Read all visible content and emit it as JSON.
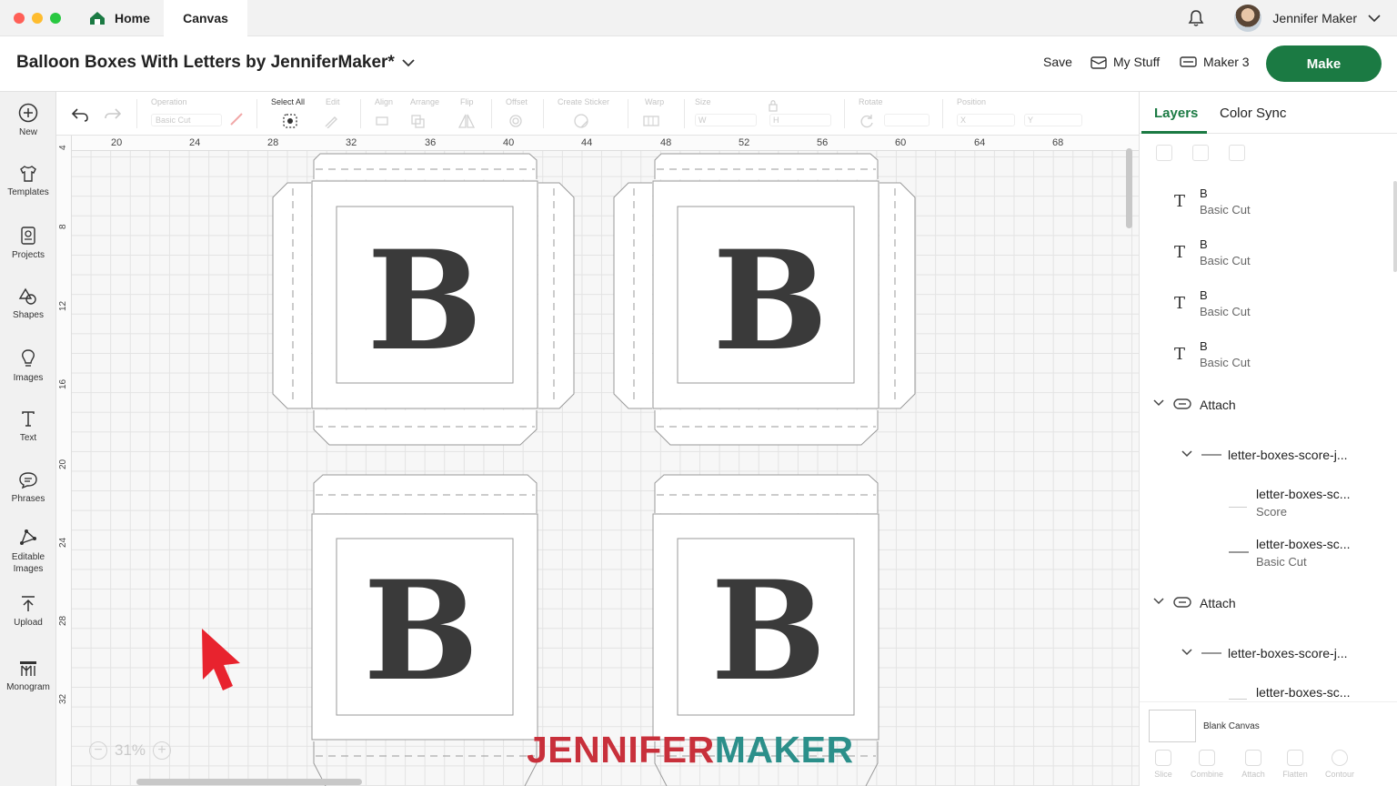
{
  "window": {
    "tabs": [
      {
        "label": "Home"
      },
      {
        "label": "Canvas"
      }
    ],
    "user_name": "Jennifer Maker"
  },
  "header": {
    "project_title": "Balloon Boxes With Letters by JenniferMaker*",
    "save_label": "Save",
    "my_stuff_label": "My Stuff",
    "machine_label": "Maker 3",
    "make_label": "Make"
  },
  "sidebar": {
    "items": [
      {
        "label": "New",
        "icon": "plus-circle-icon"
      },
      {
        "label": "Templates",
        "icon": "tshirt-icon"
      },
      {
        "label": "Projects",
        "icon": "projects-icon"
      },
      {
        "label": "Shapes",
        "icon": "shapes-icon"
      },
      {
        "label": "Images",
        "icon": "lightbulb-icon"
      },
      {
        "label": "Text",
        "icon": "text-icon"
      },
      {
        "label": "Phrases",
        "icon": "speech-bubble-icon"
      },
      {
        "label": "Editable Images",
        "icon": "editable-images-icon"
      },
      {
        "label": "Upload",
        "icon": "upload-icon"
      },
      {
        "label": "Monogram",
        "icon": "monogram-icon"
      }
    ]
  },
  "toolbar": {
    "operation_label": "Operation",
    "operation_value": "Basic Cut",
    "select_all_label": "Select All",
    "edit_label": "Edit",
    "align_label": "Align",
    "arrange_label": "Arrange",
    "flip_label": "Flip",
    "offset_label": "Offset",
    "create_sticker_label": "Create Sticker",
    "warp_label": "Warp",
    "size_label": "Size",
    "size_w": "W",
    "size_h": "H",
    "rotate_label": "Rotate",
    "position_label": "Position",
    "pos_x": "X",
    "pos_y": "Y"
  },
  "canvas": {
    "ruler_top": [
      "20",
      "24",
      "28",
      "32",
      "36",
      "40",
      "44",
      "48",
      "52",
      "56",
      "60",
      "64",
      "68"
    ],
    "ruler_left": [
      "4",
      "8",
      "12",
      "16",
      "20",
      "24",
      "28",
      "32"
    ],
    "box_letter": "B",
    "zoom": "31%",
    "zoom_minus": "−",
    "zoom_plus": "+",
    "watermark_a": "JENNIFER",
    "watermark_b": "MAKER"
  },
  "panel": {
    "tabs": [
      {
        "label": "Layers"
      },
      {
        "label": "Color Sync"
      }
    ],
    "layers": [
      {
        "name": "B",
        "sub": "Basic Cut"
      },
      {
        "name": "B",
        "sub": "Basic Cut"
      },
      {
        "name": "B",
        "sub": "Basic Cut"
      },
      {
        "name": "B",
        "sub": "Basic Cut"
      }
    ],
    "groups": [
      {
        "label": "Attach",
        "child": "letter-boxes-score-j...",
        "items": [
          {
            "name": "letter-boxes-sc...",
            "sub": "Score"
          },
          {
            "name": "letter-boxes-sc...",
            "sub": "Basic Cut"
          }
        ]
      },
      {
        "label": "Attach",
        "child": "letter-boxes-score-j...",
        "items": [
          {
            "name": "letter-boxes-sc...",
            "sub": ""
          }
        ]
      }
    ],
    "blank_canvas_label": "Blank Canvas",
    "bottom_tools": [
      "Slice",
      "Combine",
      "Attach",
      "Flatten",
      "Contour"
    ]
  },
  "colors": {
    "brand_green": "#1b7a43",
    "letter_fill": "#3a3a3a",
    "cursor_red": "#e8232e"
  }
}
